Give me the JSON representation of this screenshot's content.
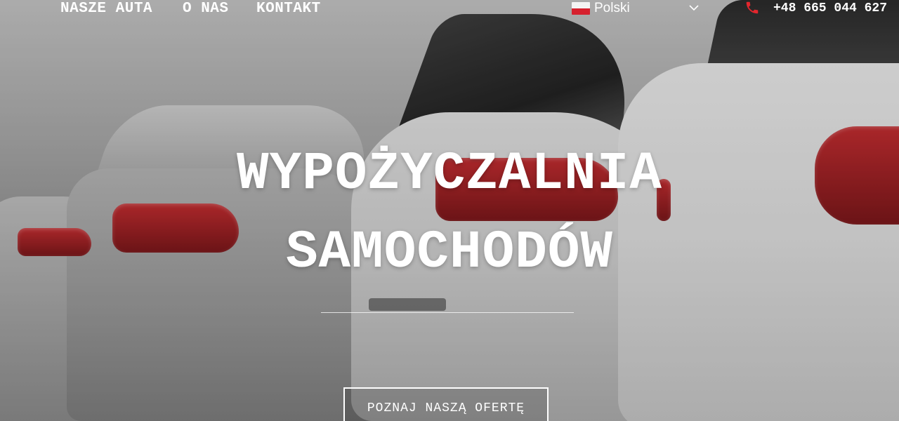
{
  "nav": {
    "items": [
      {
        "label": "NASZE AUTA"
      },
      {
        "label": "O NAS"
      },
      {
        "label": "KONTAKT"
      }
    ]
  },
  "language": {
    "selected": "Polski",
    "flag_icon": "poland-flag-icon",
    "chevron_icon": "chevron-down-icon"
  },
  "contact": {
    "phone_icon": "phone-icon",
    "phone": "+48 665 044 627",
    "icon_color": "#e3262d"
  },
  "hero": {
    "title_line1": "WYPOŻYCZALNIA",
    "title_line2": "SAMOCHODÓW",
    "cta_label": "POZNAJ NASZĄ OFERTĘ"
  }
}
